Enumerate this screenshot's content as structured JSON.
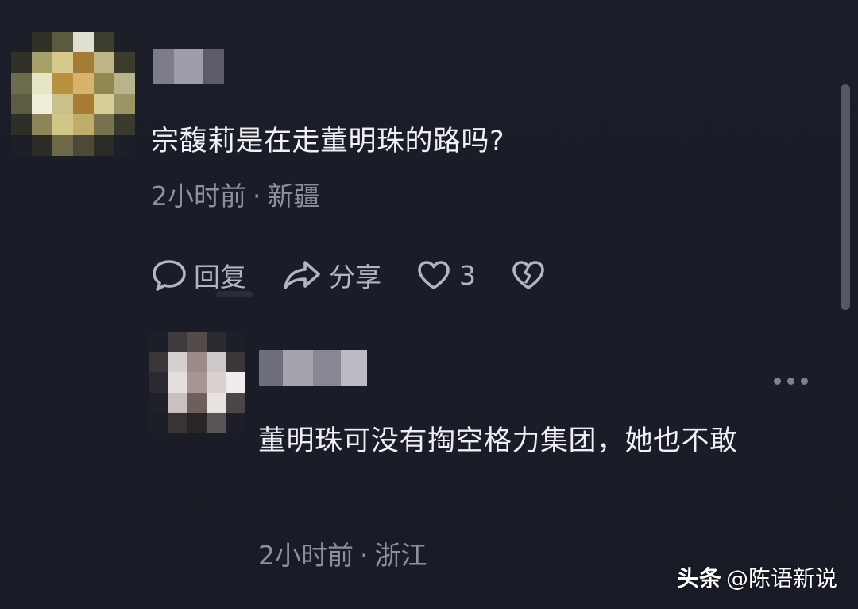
{
  "comments": [
    {
      "text": "宗馥莉是在走董明珠的路吗?",
      "time": "2小时前",
      "separator": "·",
      "location": "新疆",
      "actions": {
        "reply_label": "回复",
        "share_label": "分享",
        "like_count": "3"
      }
    },
    {
      "text": "董明珠可没有掏空格力集团，她也不敢",
      "time": "2小时前",
      "separator": "·",
      "location": "浙江"
    }
  ],
  "icons": {
    "reply": "speech-bubble-icon",
    "share": "share-arrow-icon",
    "like": "heart-icon",
    "dislike": "broken-heart-icon",
    "more": "more-dots-icon"
  },
  "watermark": {
    "brand": "头条",
    "handle": "@陈语新说"
  },
  "colors": {
    "background": "#1a1c27",
    "primary_text": "#f0f0f3",
    "meta_text": "#8d8f9b",
    "action_text": "#b2b4bf"
  }
}
